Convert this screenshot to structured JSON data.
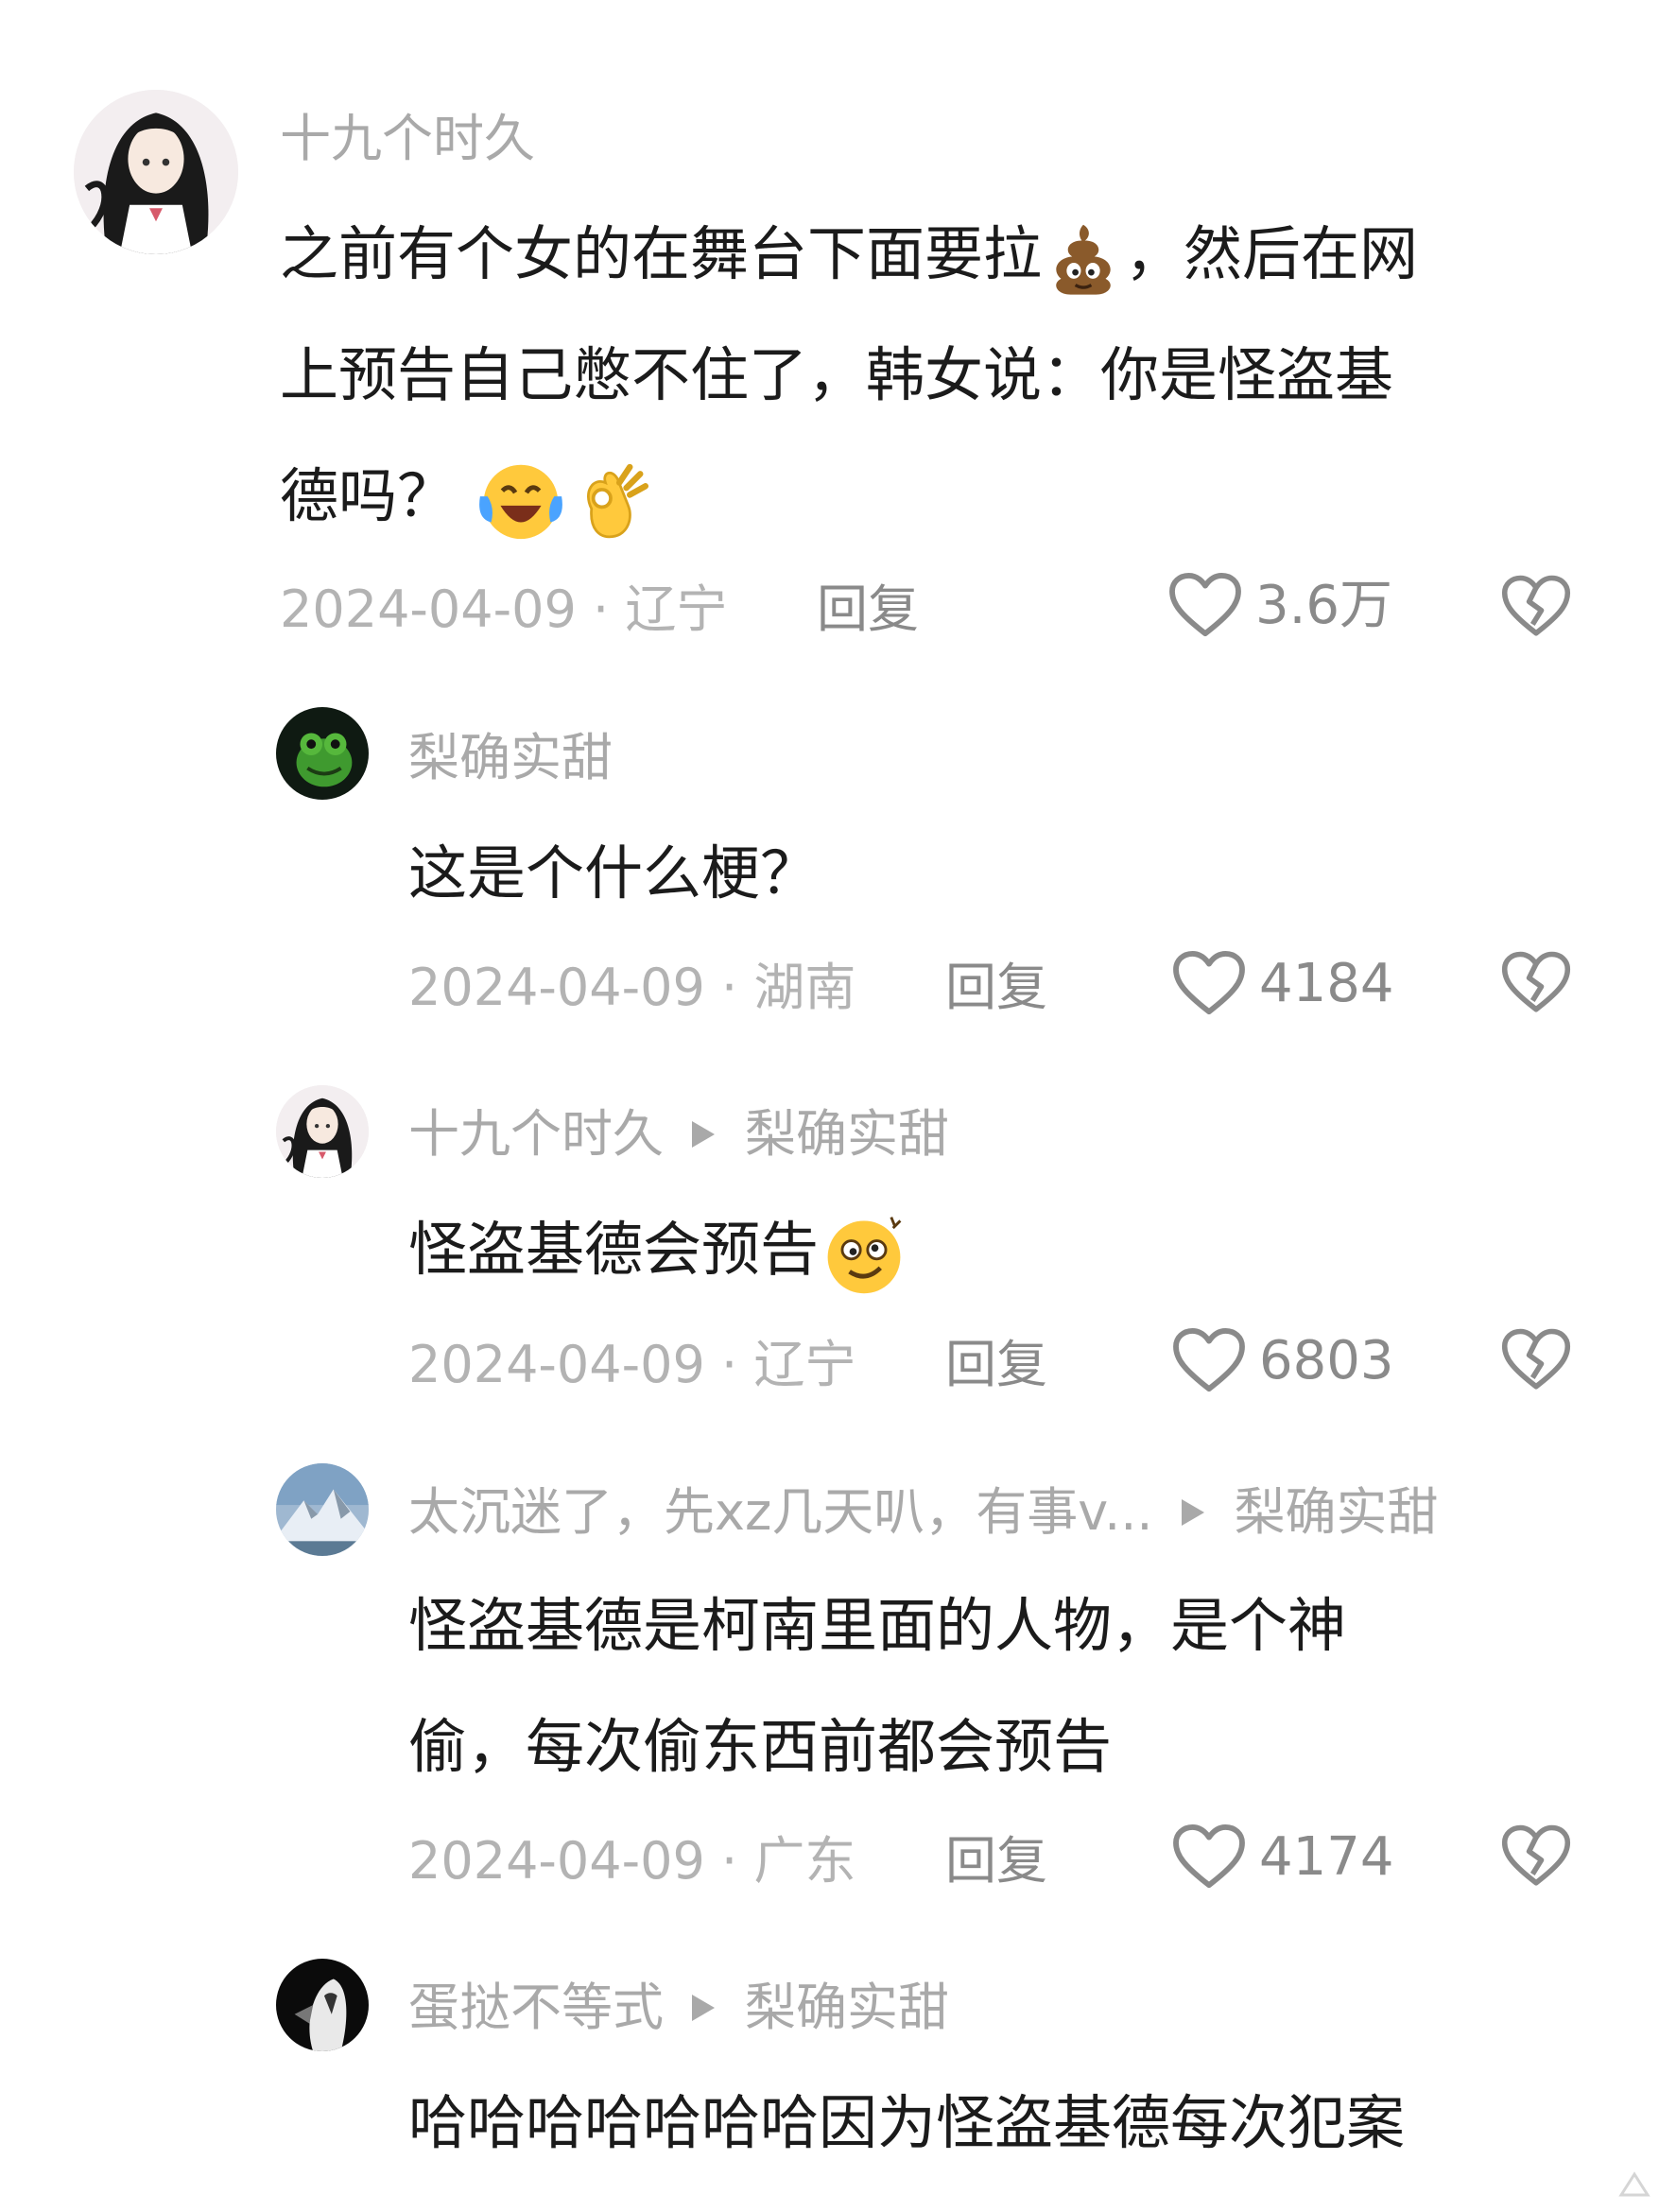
{
  "comments": [
    {
      "avatar_icon": "anime-girl-avatar",
      "name": "十九个时久",
      "reply_to": "",
      "lines": [
        "之前有个女的在舞台下面要拉",
        "，然后在网",
        "上预告自己憋不住了，韩女说：你是怪盗基",
        "德吗？"
      ],
      "date_region": "2024-04-09 · 辽宁",
      "reply_label": "回复",
      "likes": "3.6万"
    },
    {
      "avatar_icon": "green-frog-avatar",
      "name": "梨确实甜",
      "reply_to": "",
      "lines": [
        "这是个什么梗？"
      ],
      "date_region": "2024-04-09 · 湖南",
      "reply_label": "回复",
      "likes": "4184"
    },
    {
      "avatar_icon": "anime-girl-avatar",
      "name": "十九个时久",
      "reply_to": "梨确实甜",
      "lines": [
        "怪盗基德会预告"
      ],
      "date_region": "2024-04-09 · 辽宁",
      "reply_label": "回复",
      "likes": "6803"
    },
    {
      "avatar_icon": "snow-mountain-avatar",
      "name": "太沉迷了，先xz几天叭，有事v...",
      "reply_to": "梨确实甜",
      "lines": [
        "怪盗基德是柯南里面的人物，是个神",
        "偷，每次偷东西前都会预告"
      ],
      "date_region": "2024-04-09 · 广东",
      "reply_label": "回复",
      "likes": "4174"
    },
    {
      "avatar_icon": "dark-figure-avatar",
      "name": "蛋挞不等式",
      "reply_to": "梨确实甜",
      "lines": [
        "哈哈哈哈哈哈哈因为怪盗基德每次犯案"
      ],
      "date_region": "",
      "reply_label": "",
      "likes": ""
    }
  ],
  "icons": {
    "like": "heart-outline-icon",
    "dislike": "broken-heart-icon",
    "emojis": [
      "poop-emoji",
      "laughing-tears-emoji",
      "ok-hand-emoji",
      "dizzy-face-emoji"
    ]
  },
  "colors": {
    "name": "#a9a9a9",
    "text": "#1b1b1b",
    "meta": "#b3b3b3",
    "action": "#8a8a8a"
  }
}
